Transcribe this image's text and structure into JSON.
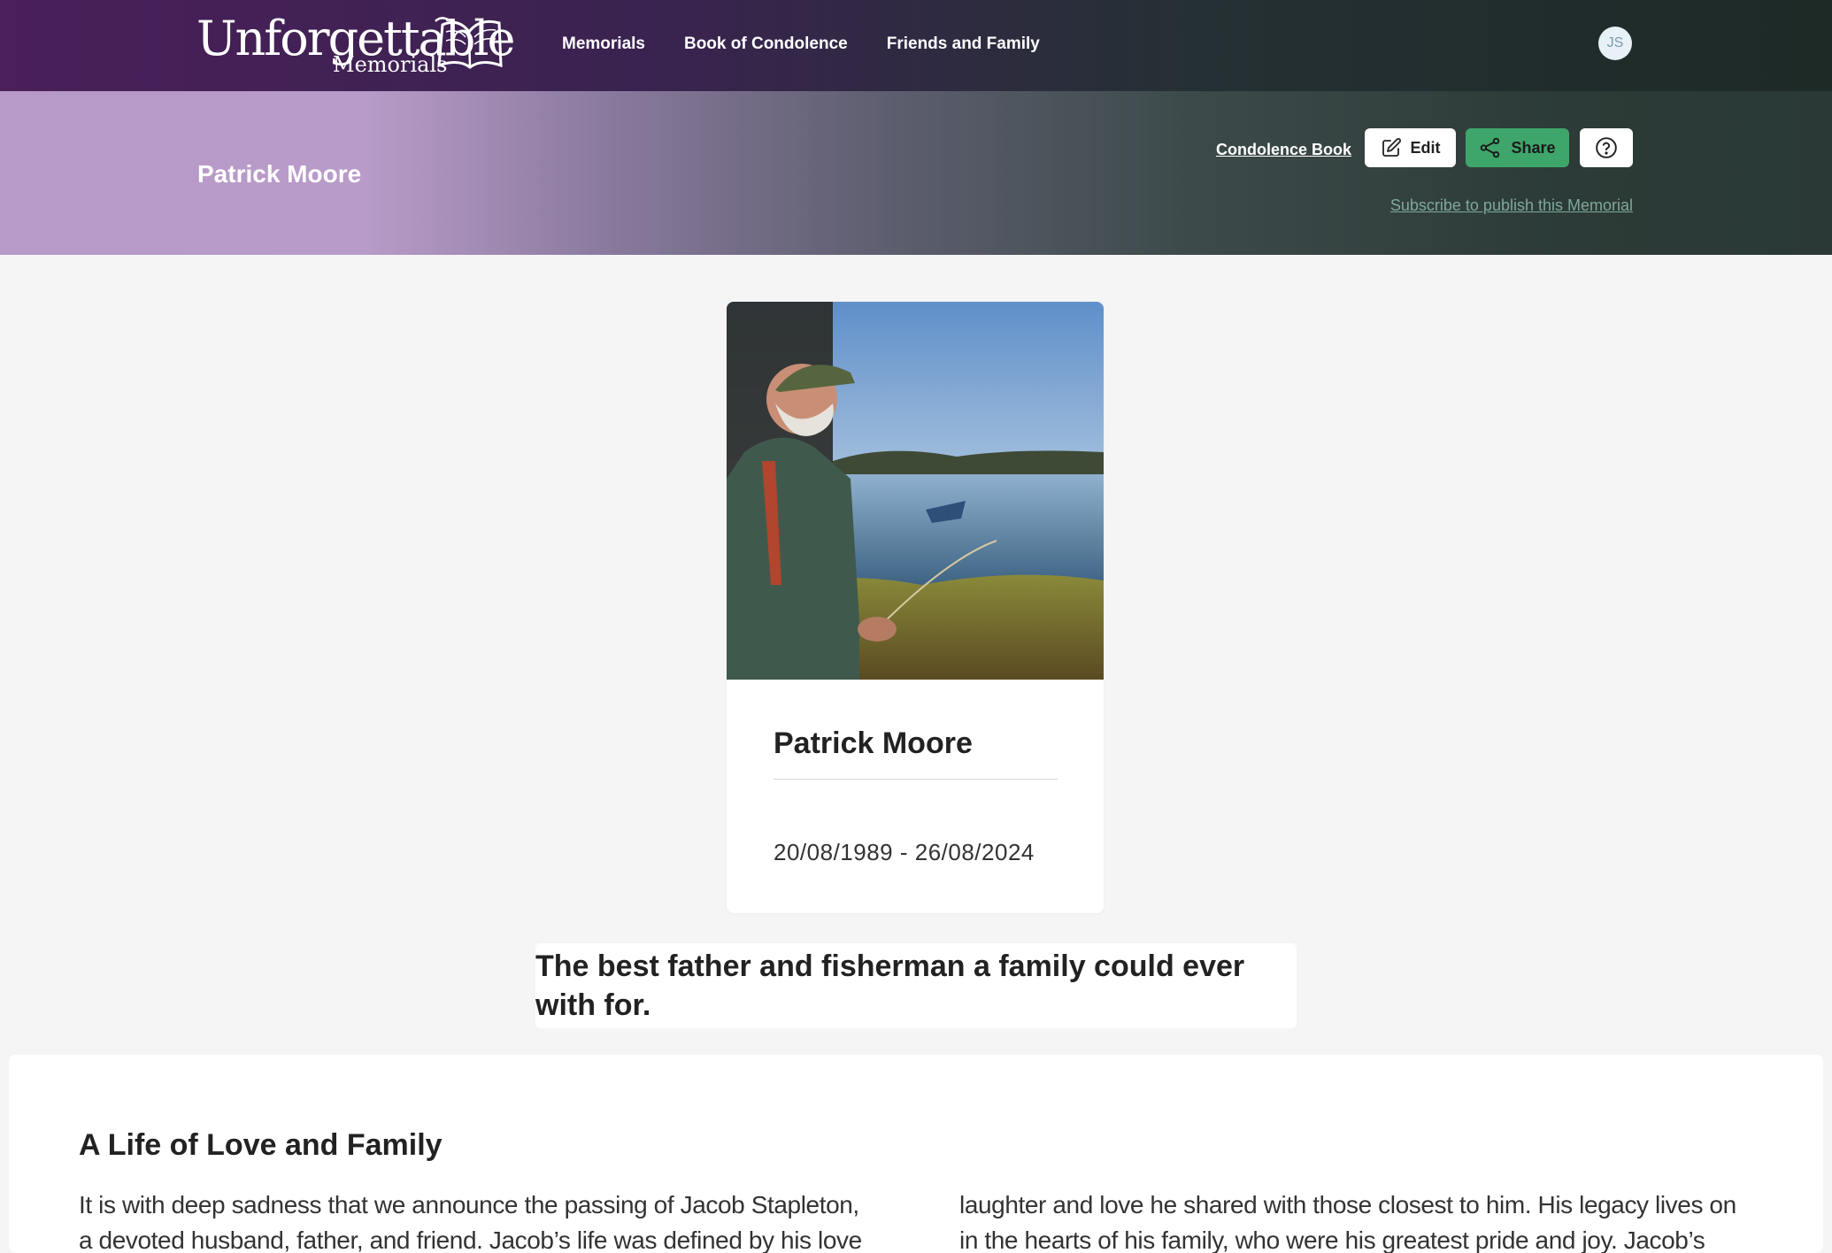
{
  "brand": {
    "logo_word": "Unforgettable",
    "logo_sub": "Memorials"
  },
  "nav": {
    "items": [
      {
        "label": "Memorials"
      },
      {
        "label": "Book of Condolence"
      },
      {
        "label": "Friends and Family"
      }
    ],
    "avatar_initials": "JS"
  },
  "banner": {
    "title": "Patrick Moore",
    "condolence_link": "Condolence Book",
    "edit_label": "Edit",
    "share_label": "Share",
    "subscribe_link": "Subscribe to publish this Memorial"
  },
  "profile": {
    "name": "Patrick Moore",
    "dates": "20/08/1989 - 26/08/2024"
  },
  "epitaph": "The best father and fisherman a family could ever with for.",
  "story": {
    "title": "A Life of Love and Family",
    "col_left": "It is with deep sadness that we announce the passing of Jacob Stapleton, a devoted husband, father, and friend. Jacob’s life was defined by his love for his",
    "col_right": "laughter and love he shared with those closest to him. His legacy lives on in the hearts of his family, who were his greatest pride and joy. Jacob’s presence will be"
  },
  "colors": {
    "accent_green": "#3fa66b",
    "nav_purple": "#4a1f5a",
    "banner_lilac": "#b89bc8"
  },
  "icons": {
    "edit": "pencil-square-icon",
    "share": "share-nodes-icon",
    "help": "question-circle-icon"
  }
}
